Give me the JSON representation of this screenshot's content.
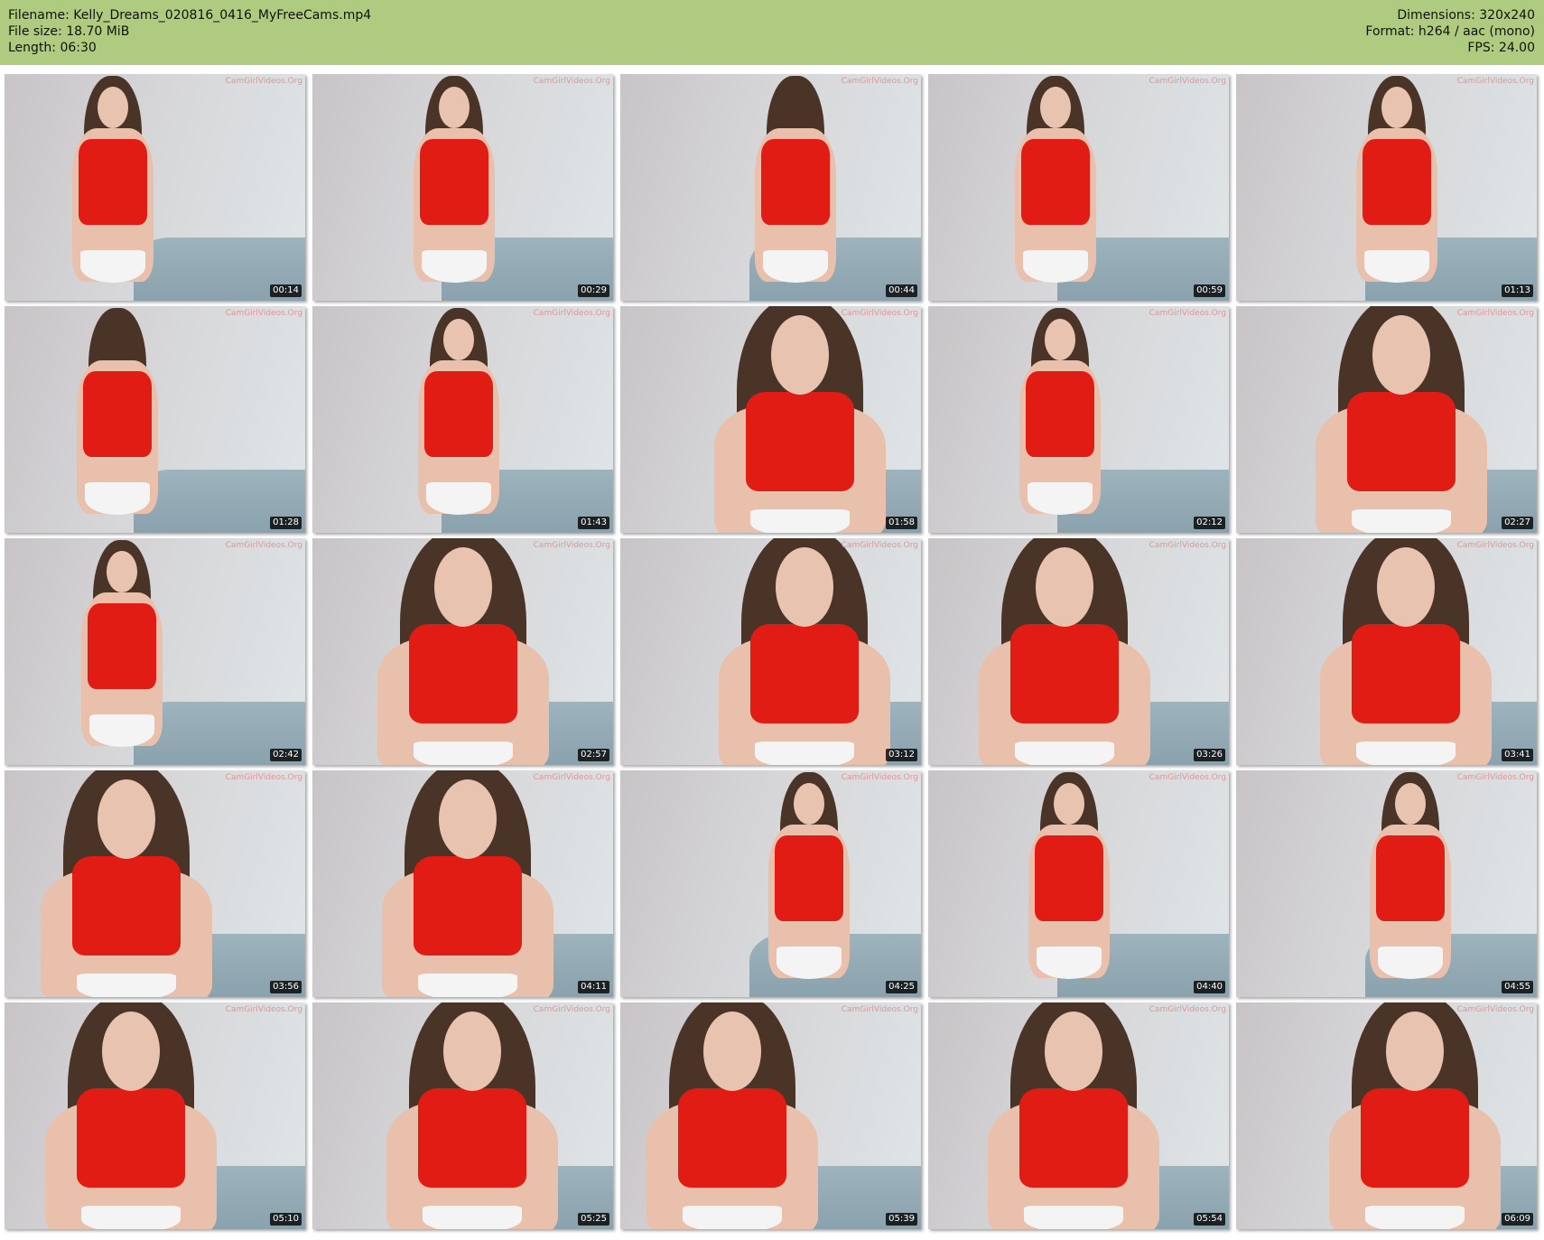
{
  "header": {
    "filename": "Filename: Kelly_Dreams_020816_0416_MyFreeCams.mp4",
    "filesize": "File size: 18.70 MiB",
    "length": "Length: 06:30",
    "dimensions": "Dimensions: 320x240",
    "format": "Format: h264 / aac (mono)",
    "fps": "FPS: 24.00",
    "background_color": "#afcb80"
  },
  "watermark": "CamGirlVideos.Org",
  "thumbnails": [
    {
      "timestamp": "00:14",
      "pose": "standing"
    },
    {
      "timestamp": "00:29",
      "pose": "standing"
    },
    {
      "timestamp": "00:44",
      "pose": "back"
    },
    {
      "timestamp": "00:59",
      "pose": "standing"
    },
    {
      "timestamp": "01:13",
      "pose": "standing"
    },
    {
      "timestamp": "01:28",
      "pose": "back"
    },
    {
      "timestamp": "01:43",
      "pose": "standing"
    },
    {
      "timestamp": "01:58",
      "pose": "close"
    },
    {
      "timestamp": "02:12",
      "pose": "standing"
    },
    {
      "timestamp": "02:27",
      "pose": "close"
    },
    {
      "timestamp": "02:42",
      "pose": "standing"
    },
    {
      "timestamp": "02:57",
      "pose": "close"
    },
    {
      "timestamp": "03:12",
      "pose": "close"
    },
    {
      "timestamp": "03:26",
      "pose": "close"
    },
    {
      "timestamp": "03:41",
      "pose": "close"
    },
    {
      "timestamp": "03:56",
      "pose": "close"
    },
    {
      "timestamp": "04:11",
      "pose": "close"
    },
    {
      "timestamp": "04:25",
      "pose": "standing"
    },
    {
      "timestamp": "04:40",
      "pose": "standing"
    },
    {
      "timestamp": "04:55",
      "pose": "standing"
    },
    {
      "timestamp": "05:10",
      "pose": "close"
    },
    {
      "timestamp": "05:25",
      "pose": "close"
    },
    {
      "timestamp": "05:39",
      "pose": "close"
    },
    {
      "timestamp": "05:54",
      "pose": "close"
    },
    {
      "timestamp": "06:09",
      "pose": "close"
    }
  ]
}
